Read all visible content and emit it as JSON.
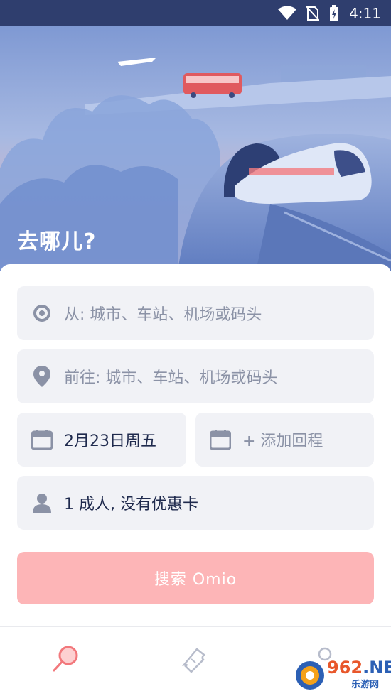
{
  "status_bar": {
    "time": "4:11",
    "icons": [
      "wifi-icon",
      "no-sim-icon",
      "battery-charging-icon"
    ]
  },
  "hero": {
    "title": "去哪儿?"
  },
  "form": {
    "from_placeholder": "从: 城市、车站、机场或码头",
    "to_placeholder": "前往: 城市、车站、机场或码头",
    "depart_date": "2月23日周五",
    "return_placeholder": "+ 添加回程",
    "passengers": "1 成人, 没有优惠卡",
    "search_label": "搜索 Omio"
  },
  "bottom_nav": {
    "items": [
      "search-icon",
      "ticket-icon",
      "profile-icon"
    ]
  },
  "watermark": {
    "brand": "962",
    "net": ".NET",
    "sub": "乐游网"
  },
  "colors": {
    "accent": "#fdb5b7",
    "primary_text": "#1f2a4d",
    "placeholder": "#8b92a6",
    "field_bg": "#f1f2f6",
    "status_bar": "#2f3e6e"
  }
}
